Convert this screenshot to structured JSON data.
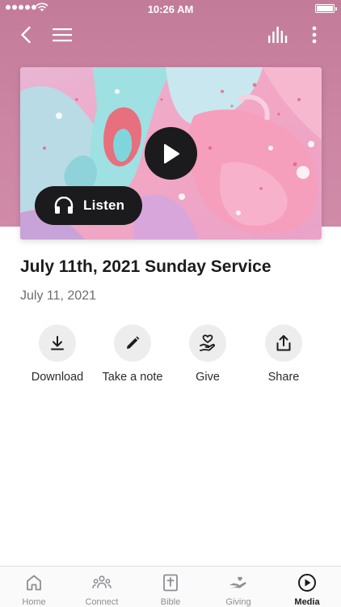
{
  "status_bar": {
    "time": "10:26 AM"
  },
  "header": {
    "back_icon": "chevron-left-icon",
    "menu_icon": "hamburger-menu-icon",
    "audio_icon": "audio-levels-icon",
    "more_icon": "vertical-ellipsis-icon"
  },
  "media": {
    "play_icon": "play-icon",
    "listen_label": "Listen",
    "listen_icon": "headphones-icon",
    "title": "July 11th, 2021 Sunday Service",
    "date": "July 11, 2021"
  },
  "actions": [
    {
      "label": "Download",
      "icon": "download-icon"
    },
    {
      "label": "Take a note",
      "icon": "pencil-icon"
    },
    {
      "label": "Give",
      "icon": "hand-heart-icon"
    },
    {
      "label": "Share",
      "icon": "share-icon"
    }
  ],
  "tabs": [
    {
      "label": "Home",
      "icon": "home-icon",
      "active": false
    },
    {
      "label": "Connect",
      "icon": "people-icon",
      "active": false
    },
    {
      "label": "Bible",
      "icon": "bible-icon",
      "active": false
    },
    {
      "label": "Giving",
      "icon": "giving-hand-icon",
      "active": false
    },
    {
      "label": "Media",
      "icon": "play-circle-icon",
      "active": true
    }
  ],
  "colors": {
    "header_background": "#c8819f",
    "play_button": "#1b1b1d",
    "action_circle": "#ededee",
    "active_tab": "#1c1c1e",
    "inactive_tab": "#8e8e93"
  }
}
